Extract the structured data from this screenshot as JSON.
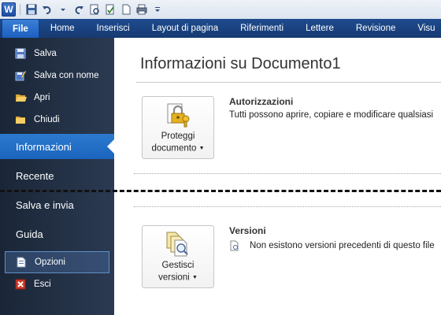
{
  "app": {
    "logo_letter": "W"
  },
  "tabs": [
    {
      "label": "File"
    },
    {
      "label": "Home"
    },
    {
      "label": "Inserisci"
    },
    {
      "label": "Layout di pagina"
    },
    {
      "label": "Riferimenti"
    },
    {
      "label": "Lettere"
    },
    {
      "label": "Revisione"
    },
    {
      "label": "Visu"
    }
  ],
  "sidebar": {
    "items": [
      {
        "label": "Salva",
        "icon": "save-icon"
      },
      {
        "label": "Salva con nome",
        "icon": "save-as-icon"
      },
      {
        "label": "Apri",
        "icon": "open-folder-icon"
      },
      {
        "label": "Chiudi",
        "icon": "close-folder-icon"
      },
      {
        "label": "Informazioni",
        "selected": true
      },
      {
        "label": "Recente"
      },
      {
        "label": "Salva e invia"
      },
      {
        "label": "Guida"
      },
      {
        "label": "Opzioni",
        "icon": "options-icon"
      },
      {
        "label": "Esci",
        "icon": "exit-icon"
      }
    ]
  },
  "main": {
    "title": "Informazioni su Documento1",
    "permissions": {
      "button_line1": "Proteggi",
      "button_line2": "documento",
      "heading": "Autorizzazioni",
      "text": "Tutti possono aprire, copiare e modificare qualsiasi"
    },
    "versions": {
      "button_line1": "Gestisci",
      "button_line2": "versioni",
      "heading": "Versioni",
      "text": "Non esistono versioni precedenti di questo file"
    }
  },
  "colors": {
    "tab_bar": "#1e4b8e",
    "file_tab": "#2a6fcf",
    "sidebar_bg": "#1a2637",
    "selected": "#2c7ad0"
  }
}
